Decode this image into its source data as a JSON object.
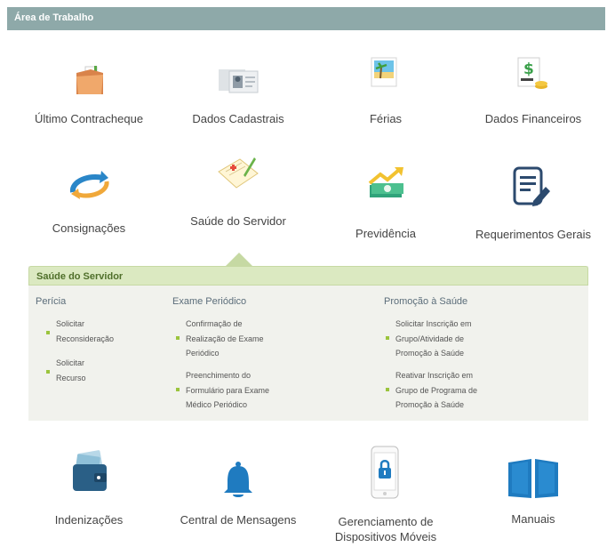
{
  "header": {
    "title": "Área de Trabalho"
  },
  "tiles": {
    "contracheque": "Último Contracheque",
    "cadastrais": "Dados Cadastrais",
    "ferias": "Férias",
    "financeiros": "Dados Financeiros",
    "consignacoes": "Consignações",
    "saude": "Saúde do Servidor",
    "previdencia": "Previdência",
    "requerimentos": "Requerimentos Gerais",
    "indenizacoes": "Indenizações",
    "mensagens": "Central de Mensagens",
    "dispositivos_l1": "Gerenciamento de",
    "dispositivos_l2": "Dispositivos Móveis",
    "manuais": "Manuais"
  },
  "panel": {
    "title": "Saúde do Servidor",
    "columns": [
      {
        "title": "Perícia",
        "links": [
          [
            "Solicitar",
            "Reconsideração"
          ],
          [
            "Solicitar",
            "Recurso"
          ]
        ]
      },
      {
        "title": "Exame Periódico",
        "links": [
          [
            "Confirmação de",
            "Realização de Exame",
            "Periódico"
          ],
          [
            "Preenchimento do",
            "Formulário para Exame",
            "Médico Periódico"
          ]
        ]
      },
      {
        "title": "Promoção à Saúde",
        "links": [
          [
            "Solicitar Inscrição em",
            "Grupo/Atividade de",
            "Promoção à Saúde"
          ],
          [
            "Reativar Inscrição em",
            "Grupo de Programa de",
            "Promoção à Saúde"
          ]
        ]
      }
    ]
  },
  "colors": {
    "header_bg": "#8ea9a9",
    "panel_head_bg": "#dbe9c1",
    "bullet": "#9bc43d",
    "icon_blue": "#1f7bc0"
  }
}
